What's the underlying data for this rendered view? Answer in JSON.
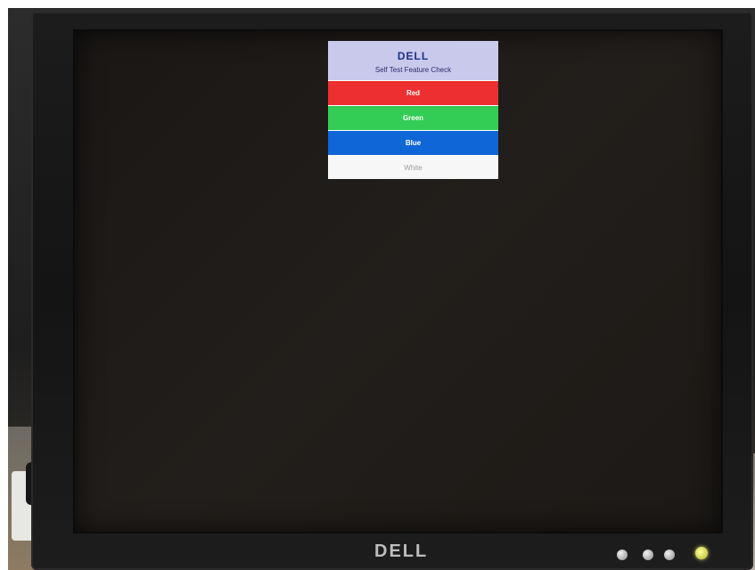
{
  "osd": {
    "logo": "DELL",
    "title": "Self Test Feature Check",
    "bars": [
      {
        "label": "Red",
        "color": "#ed2f2f"
      },
      {
        "label": "Green",
        "color": "#33cc55"
      },
      {
        "label": "Blue",
        "color": "#0f66d6"
      },
      {
        "label": "White",
        "color": "#f7f7f7"
      }
    ]
  },
  "bezel": {
    "logo": "DELL",
    "buttons": [
      "menu-button",
      "minus-button",
      "plus-button",
      "power-button"
    ]
  }
}
